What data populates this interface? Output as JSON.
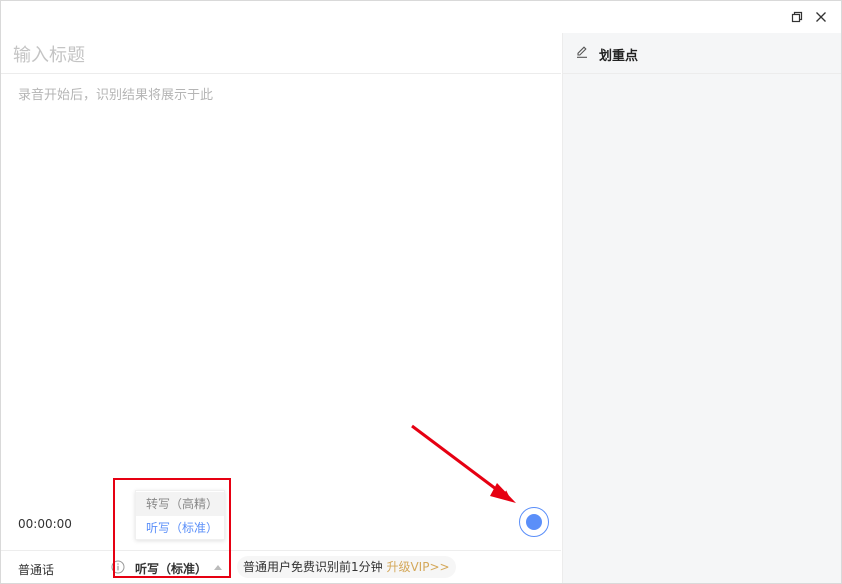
{
  "editor": {
    "title_placeholder": "输入标题",
    "body_placeholder": "录音开始后，识别结果将展示于此",
    "timer": "00:00:00"
  },
  "mode_menu": {
    "options": [
      {
        "label": "转写（高精）"
      },
      {
        "label": "听写（标准）"
      }
    ]
  },
  "bottombar": {
    "language": "普通话",
    "mode_selected": "听写（标准）",
    "promo_text": "普通用户免费识别前1分钟",
    "vip_link": "升级VIP>>"
  },
  "side_panel": {
    "title": "划重点"
  },
  "colors": {
    "accent": "#5b8ff9",
    "vip": "#d4a85a",
    "annotation": "#e60012"
  },
  "icons": [
    "restore-icon",
    "close-icon",
    "info-icon",
    "caret-up-icon",
    "pencil-icon",
    "record-icon",
    "arrow-annotation"
  ]
}
